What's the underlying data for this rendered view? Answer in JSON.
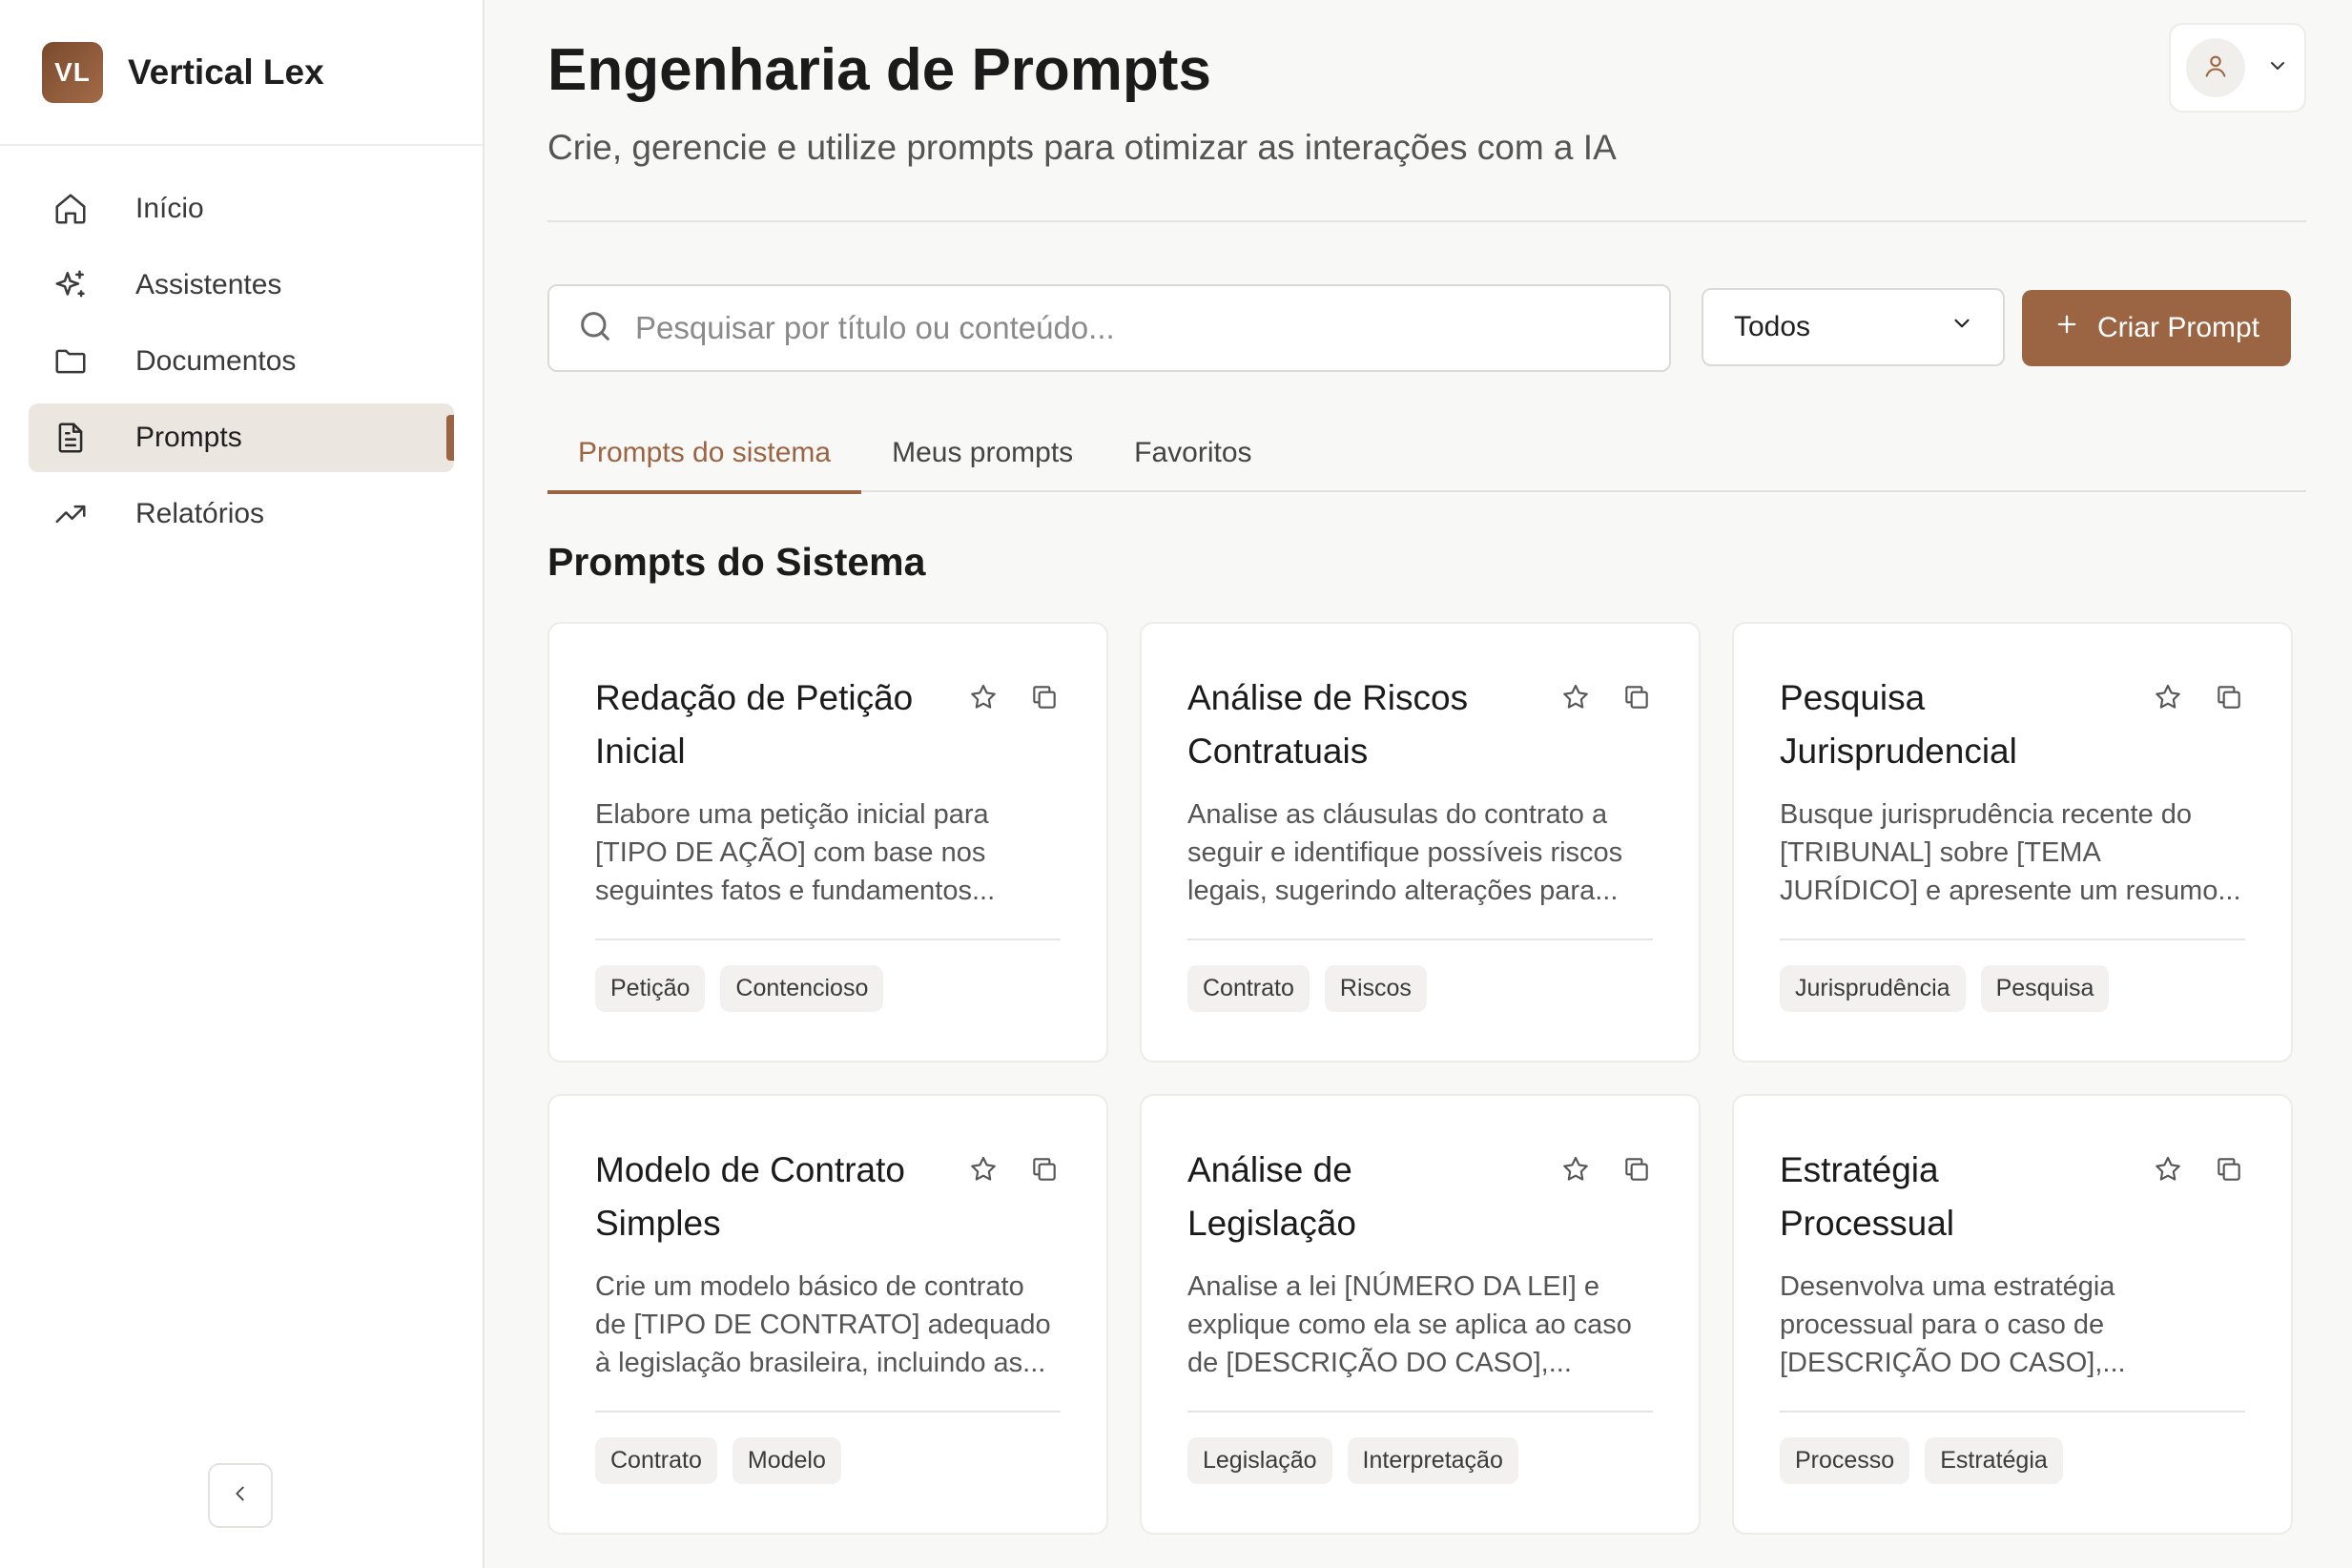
{
  "brand": {
    "initials": "VL",
    "name": "Vertical Lex"
  },
  "sidebar": {
    "items": [
      {
        "label": "Início",
        "icon": "home-icon"
      },
      {
        "label": "Assistentes",
        "icon": "sparkles-icon"
      },
      {
        "label": "Documentos",
        "icon": "folder-icon"
      },
      {
        "label": "Prompts",
        "icon": "file-text-icon",
        "active": true
      },
      {
        "label": "Relatórios",
        "icon": "trending-up-icon"
      }
    ]
  },
  "header": {
    "title": "Engenharia de Prompts",
    "subtitle": "Crie, gerencie e utilize prompts para otimizar as interações com a IA"
  },
  "search": {
    "placeholder": "Pesquisar por título ou conteúdo...",
    "value": ""
  },
  "filter": {
    "selected": "Todos"
  },
  "create_button": {
    "label": "Criar Prompt"
  },
  "tabs": [
    {
      "label": "Prompts do sistema",
      "active": true
    },
    {
      "label": "Meus prompts"
    },
    {
      "label": "Favoritos"
    }
  ],
  "section": {
    "title": "Prompts do Sistema"
  },
  "cards": [
    {
      "title": "Redação de Petição Inicial",
      "description": "Elabore uma petição inicial para [TIPO DE AÇÃO] com base nos seguintes fatos e fundamentos...",
      "tags": [
        "Petição",
        "Contencioso"
      ]
    },
    {
      "title": "Análise de Riscos Contratuais",
      "description": "Analise as cláusulas do contrato a seguir e identifique possíveis riscos legais, sugerindo alterações para...",
      "tags": [
        "Contrato",
        "Riscos"
      ]
    },
    {
      "title": "Pesquisa Jurisprudencial",
      "description": "Busque jurisprudência recente do [TRIBUNAL] sobre [TEMA JURÍDICO] e apresente um resumo...",
      "tags": [
        "Jurisprudência",
        "Pesquisa"
      ]
    },
    {
      "title": "Modelo de Contrato Simples",
      "description": "Crie um modelo básico de contrato de [TIPO DE CONTRATO] adequado à legislação brasileira, incluindo as...",
      "tags": [
        "Contrato",
        "Modelo"
      ]
    },
    {
      "title": "Análise de Legislação",
      "description": "Analise a lei [NÚMERO DA LEI] e explique como ela se aplica ao caso de [DESCRIÇÃO DO CASO],...",
      "tags": [
        "Legislação",
        "Interpretação"
      ]
    },
    {
      "title": "Estratégia Processual",
      "description": "Desenvolva uma estratégia processual para o caso de [DESCRIÇÃO DO CASO],...",
      "tags": [
        "Processo",
        "Estratégia"
      ]
    }
  ],
  "colors": {
    "accent": "#9b6443",
    "active_nav_bg": "#ece6e1",
    "background": "#f8f8f7"
  }
}
